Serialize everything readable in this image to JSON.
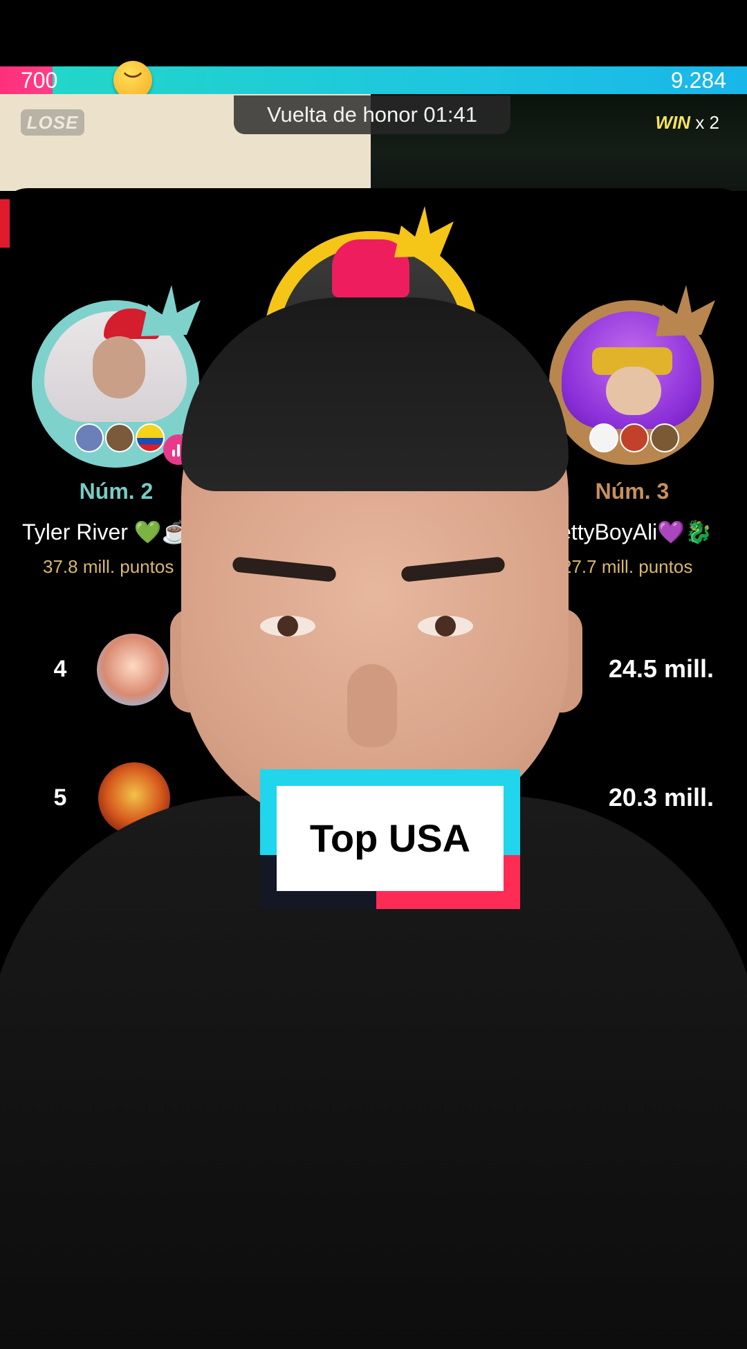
{
  "battle": {
    "score_left": "700",
    "score_right": "9.284",
    "lose_label": "LOSE",
    "win_label": "WIN",
    "win_multiplier": "x 2",
    "timer_label": "Vuelta de honor  01:41",
    "left_share": 0.07
  },
  "ranking": {
    "second": {
      "rank": "Núm. 2",
      "name": "Tyler River 💚☕",
      "points": "37.8 mill. puntos"
    },
    "third": {
      "rank": "Núm. 3",
      "name": "ettyBoyAli💜🐉",
      "points": "27.7 mill. puntos"
    },
    "rows": [
      {
        "rank": "4",
        "score": "24.5 mill."
      },
      {
        "rank": "5",
        "score": "20.3 mill."
      }
    ]
  },
  "overlay": {
    "label": "Top USA"
  },
  "colors": {
    "pink": "#fe2c55",
    "cyan": "#20d5ec",
    "gold": "#f5c518",
    "silver_teal": "#7fd1cc",
    "bronze": "#b98650"
  }
}
